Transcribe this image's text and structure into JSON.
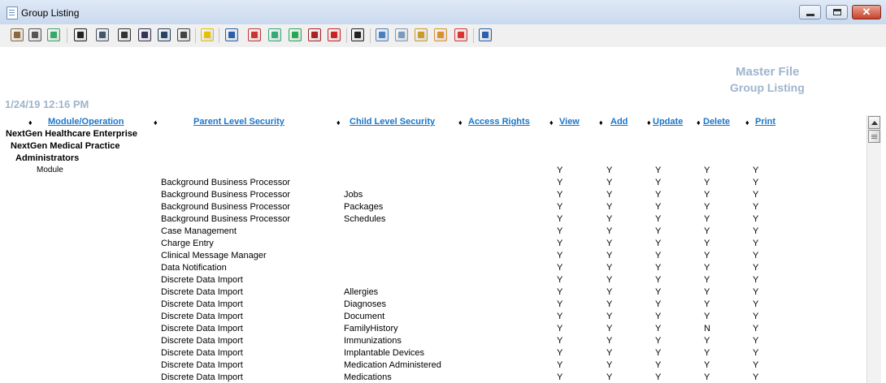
{
  "window": {
    "title": "Group Listing"
  },
  "toolbar": {
    "icons": [
      "print-preview-icon",
      "print-icon",
      "zoom-icon",
      "save-icon",
      "export-icon",
      "barcode-icon",
      "form-icon",
      "date-icon",
      "edit-icon",
      "lightning-icon",
      "checklist-icon",
      "bar-chart-icon",
      "chart-report-icon",
      "chart-export-icon",
      "report-icon",
      "export-report-icon",
      "camera-icon",
      "list-icon",
      "label-icon",
      "notepad-icon",
      "refresh-icon",
      "cancel-icon",
      "exit-icon"
    ]
  },
  "report": {
    "title": "Master File",
    "subtitle": "Group Listing",
    "datetime": "1/24/19 12:16 PM",
    "sort_marker": "♦",
    "columns": {
      "module": "Module/Operation",
      "parent": "Parent Level Security",
      "child": "Child Level Security",
      "access": "Access Rights",
      "view": "View",
      "add": "Add",
      "update": "Update",
      "delete": "Delete",
      "print": "Print"
    },
    "hierarchy": [
      "NextGen Healthcare Enterprise",
      "NextGen Medical Practice",
      "Administrators",
      "Module"
    ],
    "module_rights": [
      "Y",
      "Y",
      "Y",
      "Y",
      "Y"
    ],
    "rows": [
      {
        "parent": "Background Business Processor",
        "child": "",
        "rights": [
          "Y",
          "Y",
          "Y",
          "Y",
          "Y"
        ]
      },
      {
        "parent": "Background Business Processor",
        "child": "Jobs",
        "rights": [
          "Y",
          "Y",
          "Y",
          "Y",
          "Y"
        ]
      },
      {
        "parent": "Background Business Processor",
        "child": "Packages",
        "rights": [
          "Y",
          "Y",
          "Y",
          "Y",
          "Y"
        ]
      },
      {
        "parent": "Background Business Processor",
        "child": "Schedules",
        "rights": [
          "Y",
          "Y",
          "Y",
          "Y",
          "Y"
        ]
      },
      {
        "parent": "Case Management",
        "child": "",
        "rights": [
          "Y",
          "Y",
          "Y",
          "Y",
          "Y"
        ]
      },
      {
        "parent": "Charge Entry",
        "child": "",
        "rights": [
          "Y",
          "Y",
          "Y",
          "Y",
          "Y"
        ]
      },
      {
        "parent": "Clinical Message Manager",
        "child": "",
        "rights": [
          "Y",
          "Y",
          "Y",
          "Y",
          "Y"
        ]
      },
      {
        "parent": "Data Notification",
        "child": "",
        "rights": [
          "Y",
          "Y",
          "Y",
          "Y",
          "Y"
        ]
      },
      {
        "parent": "Discrete Data Import",
        "child": "",
        "rights": [
          "Y",
          "Y",
          "Y",
          "Y",
          "Y"
        ]
      },
      {
        "parent": "Discrete Data Import",
        "child": "Allergies",
        "rights": [
          "Y",
          "Y",
          "Y",
          "Y",
          "Y"
        ]
      },
      {
        "parent": "Discrete Data Import",
        "child": "Diagnoses",
        "rights": [
          "Y",
          "Y",
          "Y",
          "Y",
          "Y"
        ]
      },
      {
        "parent": "Discrete Data Import",
        "child": "Document",
        "rights": [
          "Y",
          "Y",
          "Y",
          "Y",
          "Y"
        ]
      },
      {
        "parent": "Discrete Data Import",
        "child": "FamilyHistory",
        "rights": [
          "Y",
          "Y",
          "Y",
          "N",
          "Y"
        ]
      },
      {
        "parent": "Discrete Data Import",
        "child": "Immunizations",
        "rights": [
          "Y",
          "Y",
          "Y",
          "Y",
          "Y"
        ]
      },
      {
        "parent": "Discrete Data Import",
        "child": "Implantable Devices",
        "rights": [
          "Y",
          "Y",
          "Y",
          "Y",
          "Y"
        ]
      },
      {
        "parent": "Discrete Data Import",
        "child": "Medication Administered",
        "rights": [
          "Y",
          "Y",
          "Y",
          "Y",
          "Y"
        ]
      },
      {
        "parent": "Discrete Data Import",
        "child": "Medications",
        "rights": [
          "Y",
          "Y",
          "Y",
          "Y",
          "Y"
        ]
      }
    ]
  }
}
